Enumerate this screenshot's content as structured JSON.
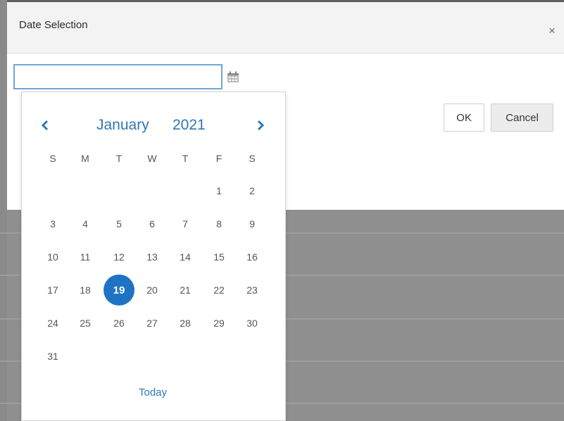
{
  "dialog": {
    "title": "Date Selection",
    "close_symbol": "×",
    "ok_label": "OK",
    "cancel_label": "Cancel"
  },
  "date_input": {
    "value": "",
    "placeholder": ""
  },
  "calendar_icon": "calendar-icon",
  "datepicker": {
    "month": "January",
    "year": "2021",
    "prev_icon": "chevron-left-icon",
    "next_icon": "chevron-right-icon",
    "weekdays": [
      "S",
      "M",
      "T",
      "W",
      "T",
      "F",
      "S"
    ],
    "weeks": [
      [
        "",
        "",
        "",
        "",
        "",
        "1",
        "2"
      ],
      [
        "3",
        "4",
        "5",
        "6",
        "7",
        "8",
        "9"
      ],
      [
        "10",
        "11",
        "12",
        "13",
        "14",
        "15",
        "16"
      ],
      [
        "17",
        "18",
        "19",
        "20",
        "21",
        "22",
        "23"
      ],
      [
        "24",
        "25",
        "26",
        "27",
        "28",
        "29",
        "30"
      ],
      [
        "31",
        "",
        "",
        "",
        "",
        "",
        ""
      ]
    ],
    "selected_day": "19",
    "today_label": "Today"
  },
  "colors": {
    "accent": "#2f78b7",
    "selected_fill": "#1f73c4",
    "input_border": "#6fa6d6",
    "backdrop": "#8f8f8f"
  }
}
